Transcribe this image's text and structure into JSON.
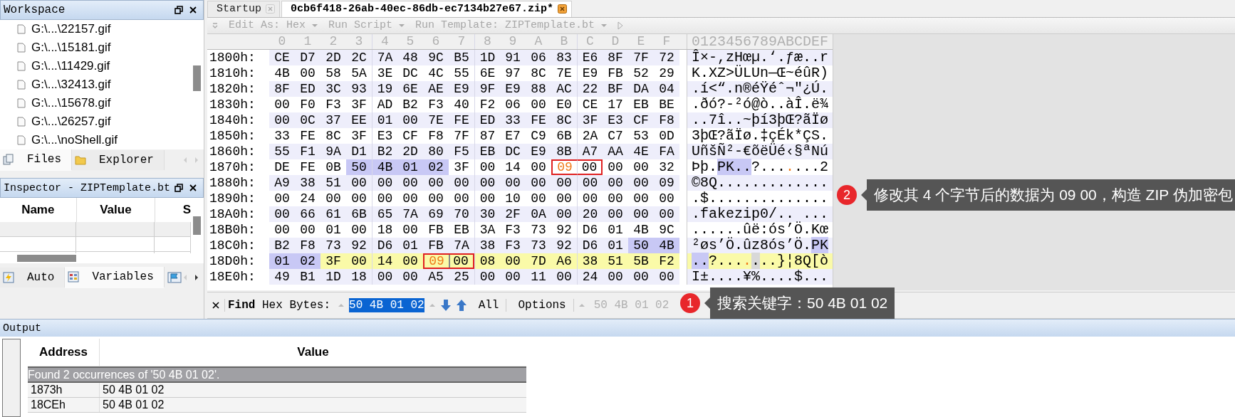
{
  "workspace": {
    "title": "Workspace",
    "files": [
      "G:\\...\\22157.gif",
      "G:\\...\\15181.gif",
      "G:\\...\\11429.gif",
      "G:\\...\\32413.gif",
      "G:\\...\\15678.gif",
      "G:\\...\\26257.gif",
      "G:\\...\\noShell.gif"
    ],
    "tabs": [
      {
        "label": "Files",
        "selected": true
      },
      {
        "label": "Explorer",
        "selected": false
      }
    ]
  },
  "inspector": {
    "title": "Inspector - ZIPTemplate.bt",
    "columns": [
      "Name",
      "Value",
      "S"
    ],
    "tabs": [
      {
        "label": "Auto",
        "selected": false
      },
      {
        "label": "Variables",
        "selected": true
      }
    ]
  },
  "editor": {
    "tabs": [
      {
        "label": "Startup",
        "selected": false
      },
      {
        "label": "0cb6f418-26ab-40ec-86db-ec7134b27e67.zip*",
        "selected": true
      }
    ],
    "toolbar": [
      "Edit As: Hex",
      "Run Script",
      "Run Template: ZIPTemplate.bt"
    ],
    "column_headers": [
      "0",
      "1",
      "2",
      "3",
      "4",
      "5",
      "6",
      "7",
      "8",
      "9",
      "A",
      "B",
      "C",
      "D",
      "E",
      "F"
    ],
    "ascii_header": "0123456789ABCDEF",
    "rows": [
      {
        "offset": "1800h:",
        "current": false,
        "bytes": [
          "CE",
          "D7",
          "2D",
          "2C",
          "7A",
          "48",
          "9C",
          "B5",
          "1D",
          "91",
          "06",
          "83",
          "E6",
          "8F",
          "7F",
          "72"
        ],
        "ascii": [
          {
            "text": "Î×-,zHœµ.‘.ƒæ..r"
          }
        ]
      },
      {
        "offset": "1810h:",
        "current": false,
        "bytes": [
          "4B",
          "00",
          "58",
          "5A",
          "3E",
          "DC",
          "4C",
          "55",
          "6E",
          "97",
          "8C",
          "7E",
          "E9",
          "FB",
          "52",
          "29"
        ],
        "ascii": [
          {
            "text": "K.XZ>ÜLUn—Œ~éûR)"
          }
        ]
      },
      {
        "offset": "1820h:",
        "current": false,
        "bytes": [
          "8F",
          "ED",
          "3C",
          "93",
          "19",
          "6E",
          "AE",
          "E9",
          "9F",
          "E9",
          "88",
          "AC",
          "22",
          "BF",
          "DA",
          "04"
        ],
        "ascii": [
          {
            "text": ".í<“.n®éŸéˆ¬\"¿Ú."
          }
        ]
      },
      {
        "offset": "1830h:",
        "current": false,
        "bytes": [
          "00",
          "F0",
          "F3",
          "3F",
          "AD",
          "B2",
          "F3",
          "40",
          "F2",
          "06",
          "00",
          "E0",
          "CE",
          "17",
          "EB",
          "BE"
        ],
        "ascii": [
          {
            "text": ".ðó?-²ó@ò..àÎ.ë¾"
          }
        ]
      },
      {
        "offset": "1840h:",
        "current": false,
        "bytes": [
          "00",
          "0C",
          "37",
          "EE",
          "01",
          "00",
          "7E",
          "FE",
          "ED",
          "33",
          "FE",
          "8C",
          "3F",
          "E3",
          "CF",
          "F8"
        ],
        "ascii": [
          {
            "text": "..7î..~þí3þŒ?ãÏø"
          }
        ]
      },
      {
        "offset": "1850h:",
        "current": false,
        "bytes": [
          "33",
          "FE",
          "8C",
          "3F",
          "E3",
          "CF",
          "F8",
          "7F",
          "87",
          "E7",
          "C9",
          "6B",
          "2A",
          "C7",
          "53",
          "0D"
        ],
        "ascii": [
          {
            "text": "3þŒ?ãÏø.‡çÉk*ÇS."
          }
        ]
      },
      {
        "offset": "1860h:",
        "current": false,
        "bytes": [
          "55",
          "F1",
          "9A",
          "D1",
          "B2",
          "2D",
          "80",
          "F5",
          "EB",
          "DC",
          "E9",
          "8B",
          "A7",
          "AA",
          "4E",
          "FA"
        ],
        "ascii": [
          {
            "text": "UñšÑ²-€õëÜé‹§ªNú"
          }
        ]
      },
      {
        "offset": "1870h:",
        "current": false,
        "bytes": [
          "DE",
          "FE",
          "0B",
          {
            "value": "50",
            "selected": true
          },
          {
            "value": "4B",
            "selected": true
          },
          {
            "value": "01",
            "selected": true
          },
          {
            "value": "02",
            "selected": true
          },
          "3F",
          "00",
          "14",
          "00",
          {
            "value": "09",
            "changed": true,
            "boxed": true
          },
          {
            "value": "00",
            "boxed": true
          },
          "00",
          "00",
          "32"
        ],
        "ascii": [
          {
            "text": "Þþ."
          },
          {
            "text": "PK..",
            "selected": true
          },
          {
            "text": "?..."
          },
          {
            "text": ".",
            "changed": true
          },
          {
            "text": "...2"
          }
        ]
      },
      {
        "offset": "1880h:",
        "current": false,
        "bytes": [
          "A9",
          "38",
          "51",
          "00",
          "00",
          "00",
          "00",
          "00",
          "00",
          "00",
          "00",
          "00",
          "00",
          "00",
          "00",
          "09"
        ],
        "ascii": [
          {
            "text": "©8Q............."
          }
        ]
      },
      {
        "offset": "1890h:",
        "current": false,
        "bytes": [
          "00",
          "24",
          "00",
          "00",
          "00",
          "00",
          "00",
          "00",
          "00",
          "10",
          "00",
          "00",
          "00",
          "00",
          "00",
          "00"
        ],
        "ascii": [
          {
            "text": ".$.............."
          }
        ]
      },
      {
        "offset": "18A0h:",
        "current": false,
        "bytes": [
          "00",
          "66",
          "61",
          "6B",
          "65",
          "7A",
          "69",
          "70",
          "30",
          "2F",
          "0A",
          "00",
          "20",
          "00",
          "00",
          "00"
        ],
        "ascii": [
          {
            "text": ".fakezip0/.. ..."
          }
        ]
      },
      {
        "offset": "18B0h:",
        "current": false,
        "bytes": [
          "00",
          "00",
          "01",
          "00",
          "18",
          "00",
          "FB",
          "EB",
          "3A",
          "F3",
          "73",
          "92",
          "D6",
          "01",
          "4B",
          "9C"
        ],
        "ascii": [
          {
            "text": "......ûë:ós’Ö.Kœ"
          }
        ]
      },
      {
        "offset": "18C0h:",
        "current": false,
        "bytes": [
          "B2",
          "F8",
          "73",
          "92",
          "D6",
          "01",
          "FB",
          "7A",
          "38",
          "F3",
          "73",
          "92",
          "D6",
          "01",
          {
            "value": "50",
            "selected": true
          },
          {
            "value": "4B",
            "selected": true
          }
        ],
        "ascii": [
          {
            "text": "²øs’Ö.ûz8ós’Ö."
          },
          {
            "text": "PK",
            "selected": true
          }
        ]
      },
      {
        "offset": "18D0h:",
        "current": true,
        "bytes": [
          {
            "value": "01",
            "selected": true
          },
          {
            "value": "02",
            "selected": true
          },
          "3F",
          "00",
          "14",
          "00",
          {
            "value": "09",
            "changed": true,
            "boxed": true
          },
          {
            "value": "00",
            "boxed": true,
            "cursor": true
          },
          "08",
          "00",
          "7D",
          "A6",
          "38",
          "51",
          "5B",
          "F2"
        ],
        "ascii": [
          {
            "text": "..",
            "selected": true
          },
          {
            "text": "?..."
          },
          {
            "text": ".",
            "changed": true
          },
          {
            "text": ".",
            "cursor": true
          },
          {
            "text": "..}¦8Q[ò"
          }
        ]
      },
      {
        "offset": "18E0h:",
        "current": false,
        "bytes": [
          "49",
          "B1",
          "1D",
          "18",
          "00",
          "00",
          "A5",
          "25",
          "00",
          "00",
          "11",
          "00",
          "24",
          "00",
          "00",
          "00"
        ],
        "ascii": [
          {
            "text": "I±....¥%....$..."
          }
        ]
      }
    ]
  },
  "find_bar": {
    "label": "Find",
    "mode": "Hex Bytes:",
    "value": "50 4B 01 02",
    "all": "All",
    "options": "Options",
    "history": "50 4B 01 02"
  },
  "callouts": [
    {
      "number": "1",
      "text": "搜索关键字：50 4B 01 02"
    },
    {
      "number": "2",
      "text": "修改其 4 个字节后的数据为 09 00，构造 ZIP 伪加密包"
    }
  ],
  "output": {
    "title": "Output",
    "columns": [
      "Address",
      "Value"
    ],
    "message": "Found 2 occurrences of '50 4B 01 02'.",
    "rows": [
      [
        "1873h",
        "50 4B 01 02"
      ],
      [
        "18CEh",
        "50 4B 01 02"
      ]
    ]
  }
}
